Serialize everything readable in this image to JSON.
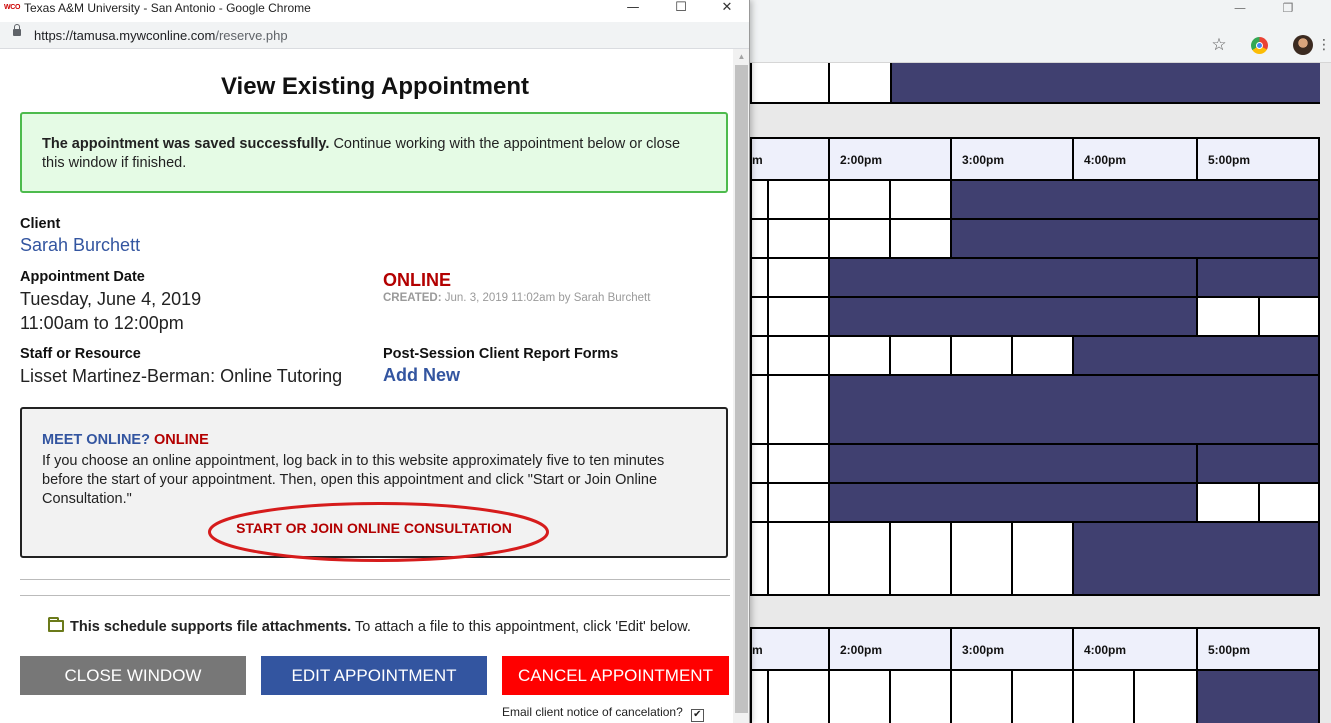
{
  "window": {
    "logo_text": "WCO",
    "title": "Texas A&M University - San Antonio - Google Chrome",
    "url_host": "https://tamusa.mywconline.com",
    "url_path": "/reserve.php"
  },
  "page": {
    "title": "View Existing Appointment"
  },
  "success": {
    "bold": "The appointment was saved successfully.",
    "rest": " Continue working with the appointment below or close this window if finished."
  },
  "client": {
    "label": "Client",
    "name": "Sarah Burchett"
  },
  "appointment": {
    "date_label": "Appointment Date",
    "date": "Tuesday, June 4, 2019",
    "time": "11:00am to 12:00pm",
    "mode": "ONLINE",
    "created_label": "CREATED:",
    "created_value": " Jun. 3, 2019 11:02am by Sarah Burchett"
  },
  "staff": {
    "label": "Staff or Resource",
    "value": "Lisset Martinez-Berman: Online Tutoring"
  },
  "reports": {
    "label": "Post-Session Client Report Forms",
    "link": "Add New"
  },
  "meet": {
    "question": "MEET ONLINE?",
    "answer": "ONLINE",
    "text": "If you choose an online appointment, log back in to this website approximately five to ten minutes before the start of your appointment. Then, open this appointment and click \"Start or Join Online Consultation.\"",
    "link": "START OR JOIN ONLINE CONSULTATION"
  },
  "attachments": {
    "bold": "This schedule supports file attachments.",
    "rest": " To attach a file to this appointment, click 'Edit' below."
  },
  "buttons": {
    "close": "CLOSE WINDOW",
    "edit": "EDIT APPOINTMENT",
    "cancel": "CANCEL APPOINTMENT"
  },
  "email_notice": {
    "label": "Email client notice of cancelation?",
    "checked": true
  },
  "schedule": {
    "times": [
      "m",
      "2:00pm",
      "3:00pm",
      "4:00pm",
      "5:00pm"
    ],
    "block_color": "#404070"
  },
  "colors": {
    "accent_blue": "#3355a0",
    "alert_red": "#b30000",
    "success_green": "#4dbb4d"
  }
}
